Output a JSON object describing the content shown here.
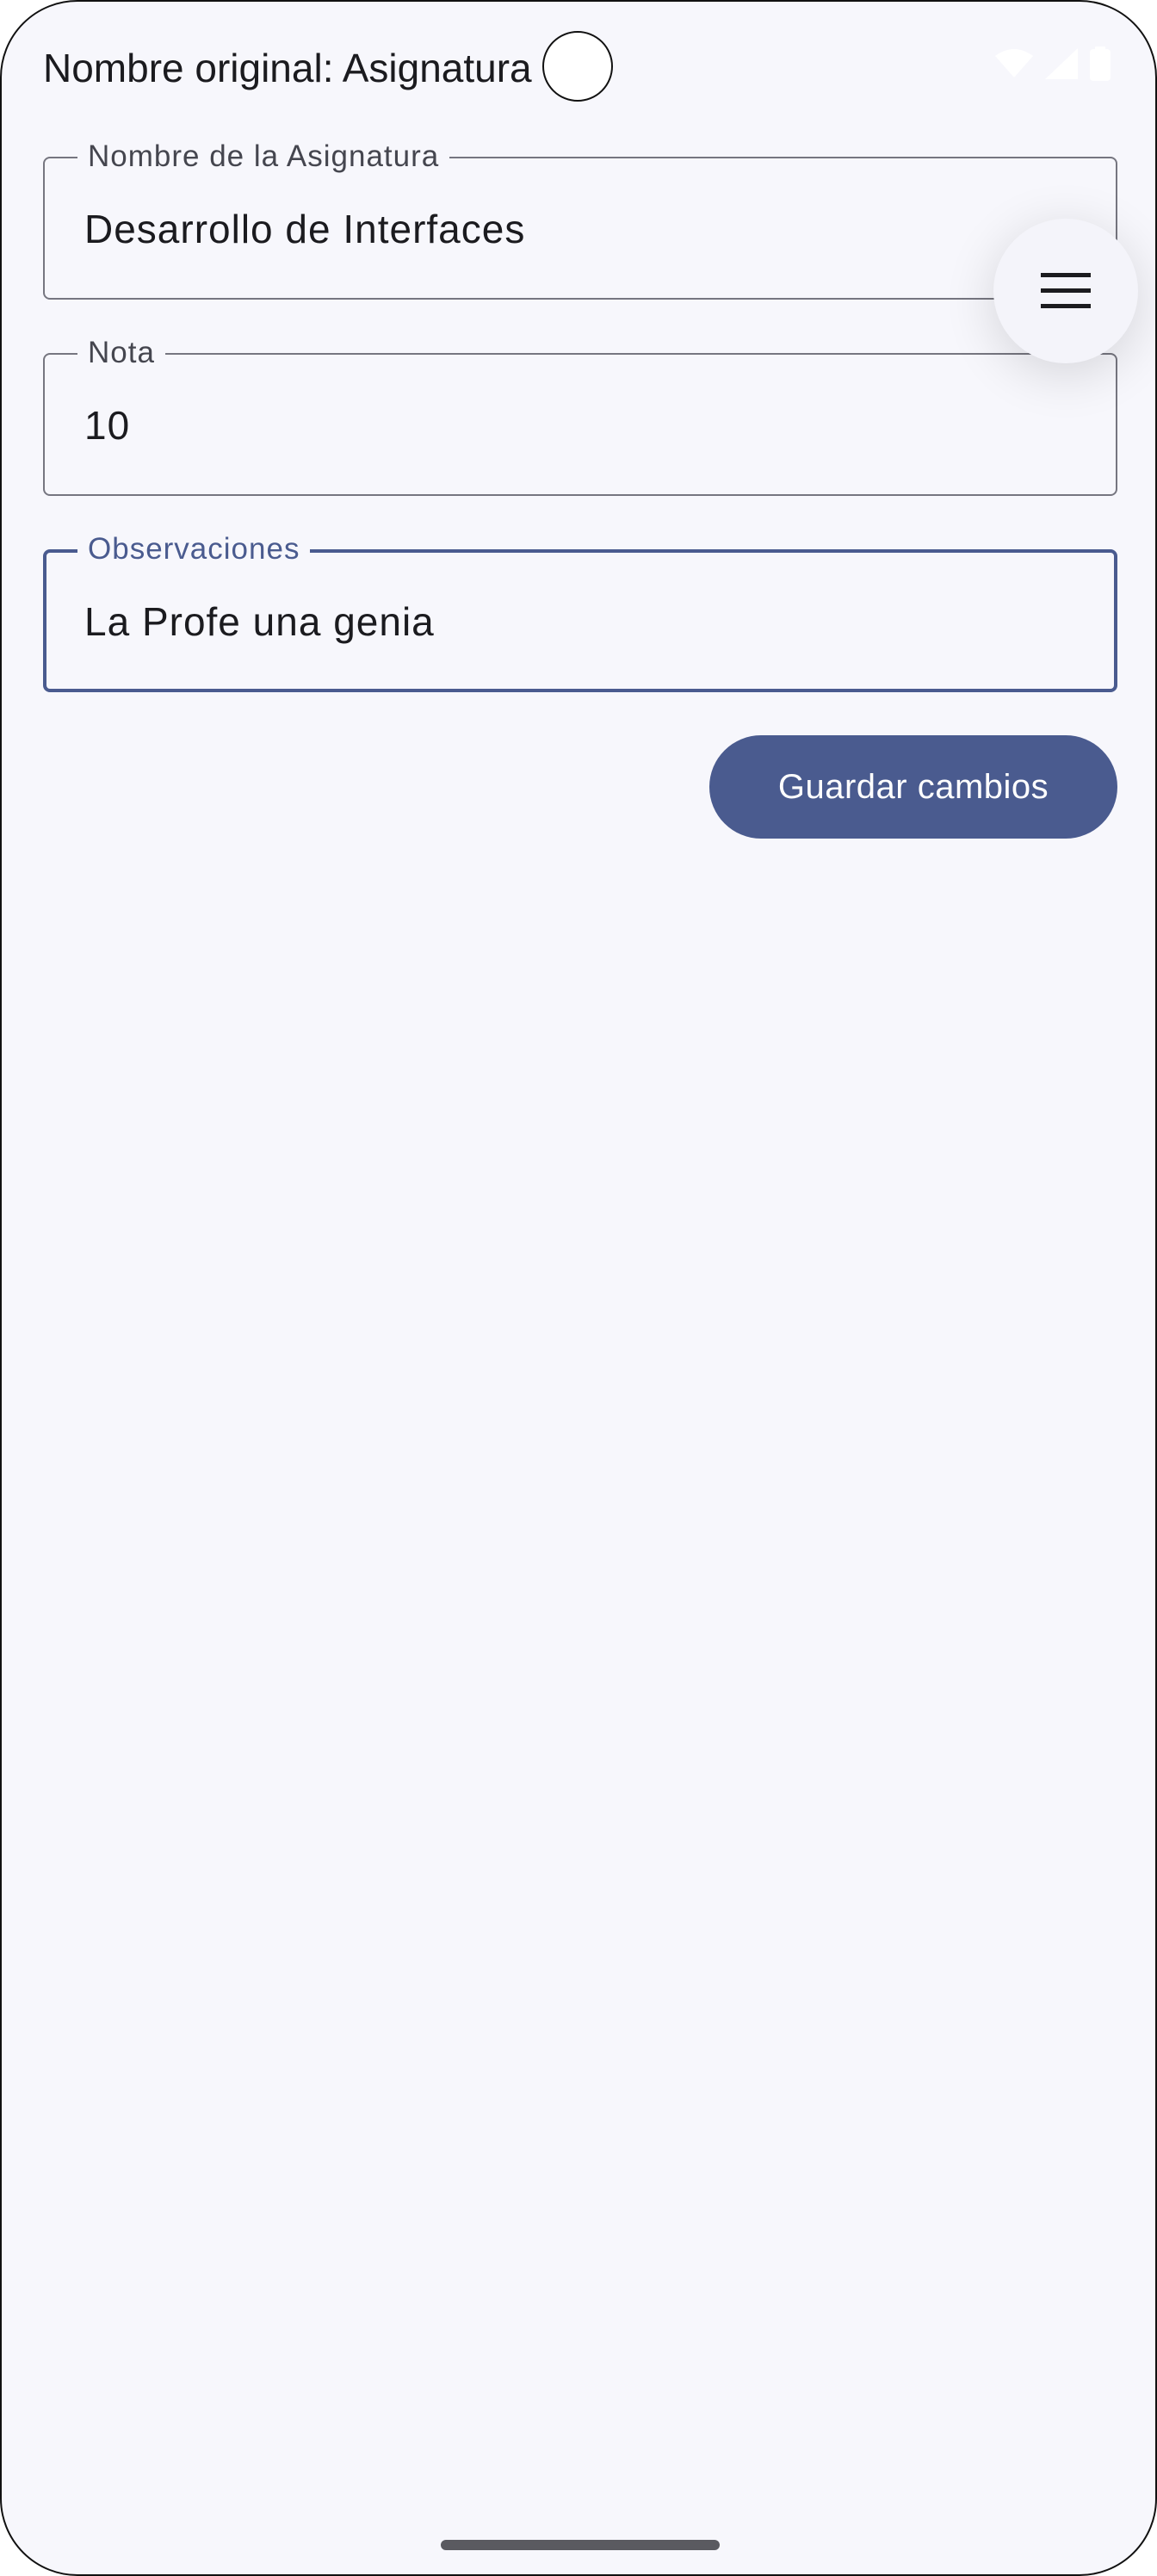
{
  "status_bar": {
    "title": "Nombre original: Asignatura"
  },
  "form": {
    "subject_name": {
      "label": "Nombre de la Asignatura",
      "value": "Desarrollo de Interfaces"
    },
    "grade": {
      "label": "Nota",
      "value": "10"
    },
    "observations": {
      "label": "Observaciones",
      "value": "La Profe una genia"
    },
    "save_label": "Guardar cambios"
  },
  "menu": {
    "icon": "menu-icon"
  },
  "colors": {
    "primary": "#4a5b8f",
    "background": "#f7f7fc",
    "outline": "#767680",
    "text": "#1b1b1f"
  }
}
